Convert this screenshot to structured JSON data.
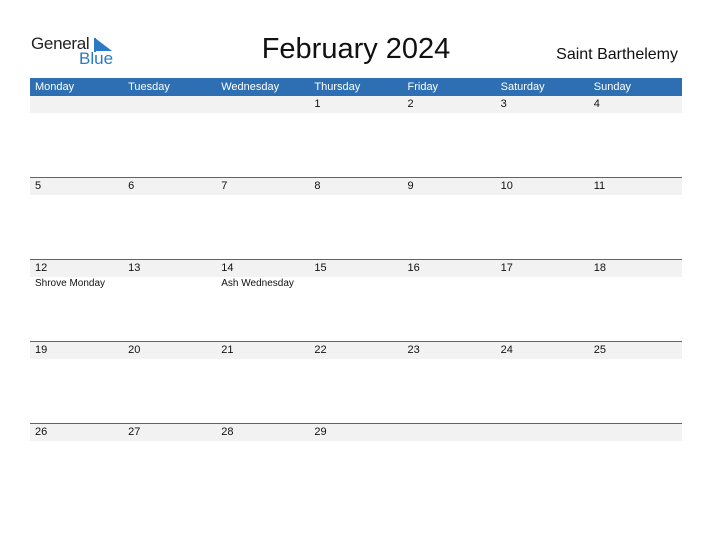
{
  "logo": {
    "general": "General",
    "blue": "Blue",
    "accent": "#2a7bc4"
  },
  "title": "February 2024",
  "country": "Saint Barthelemy",
  "colors": {
    "header_bg": "#2e6fb3",
    "band_bg": "#f2f2f2"
  },
  "weekdays": [
    "Monday",
    "Tuesday",
    "Wednesday",
    "Thursday",
    "Friday",
    "Saturday",
    "Sunday"
  ],
  "weeks": [
    [
      {
        "day": ""
      },
      {
        "day": ""
      },
      {
        "day": ""
      },
      {
        "day": "1"
      },
      {
        "day": "2"
      },
      {
        "day": "3"
      },
      {
        "day": "4"
      }
    ],
    [
      {
        "day": "5"
      },
      {
        "day": "6"
      },
      {
        "day": "7"
      },
      {
        "day": "8"
      },
      {
        "day": "9"
      },
      {
        "day": "10"
      },
      {
        "day": "11"
      }
    ],
    [
      {
        "day": "12",
        "event": "Shrove Monday"
      },
      {
        "day": "13"
      },
      {
        "day": "14",
        "event": "Ash Wednesday"
      },
      {
        "day": "15"
      },
      {
        "day": "16"
      },
      {
        "day": "17"
      },
      {
        "day": "18"
      }
    ],
    [
      {
        "day": "19"
      },
      {
        "day": "20"
      },
      {
        "day": "21"
      },
      {
        "day": "22"
      },
      {
        "day": "23"
      },
      {
        "day": "24"
      },
      {
        "day": "25"
      }
    ],
    [
      {
        "day": "26"
      },
      {
        "day": "27"
      },
      {
        "day": "28"
      },
      {
        "day": "29"
      },
      {
        "day": ""
      },
      {
        "day": ""
      },
      {
        "day": ""
      }
    ]
  ]
}
